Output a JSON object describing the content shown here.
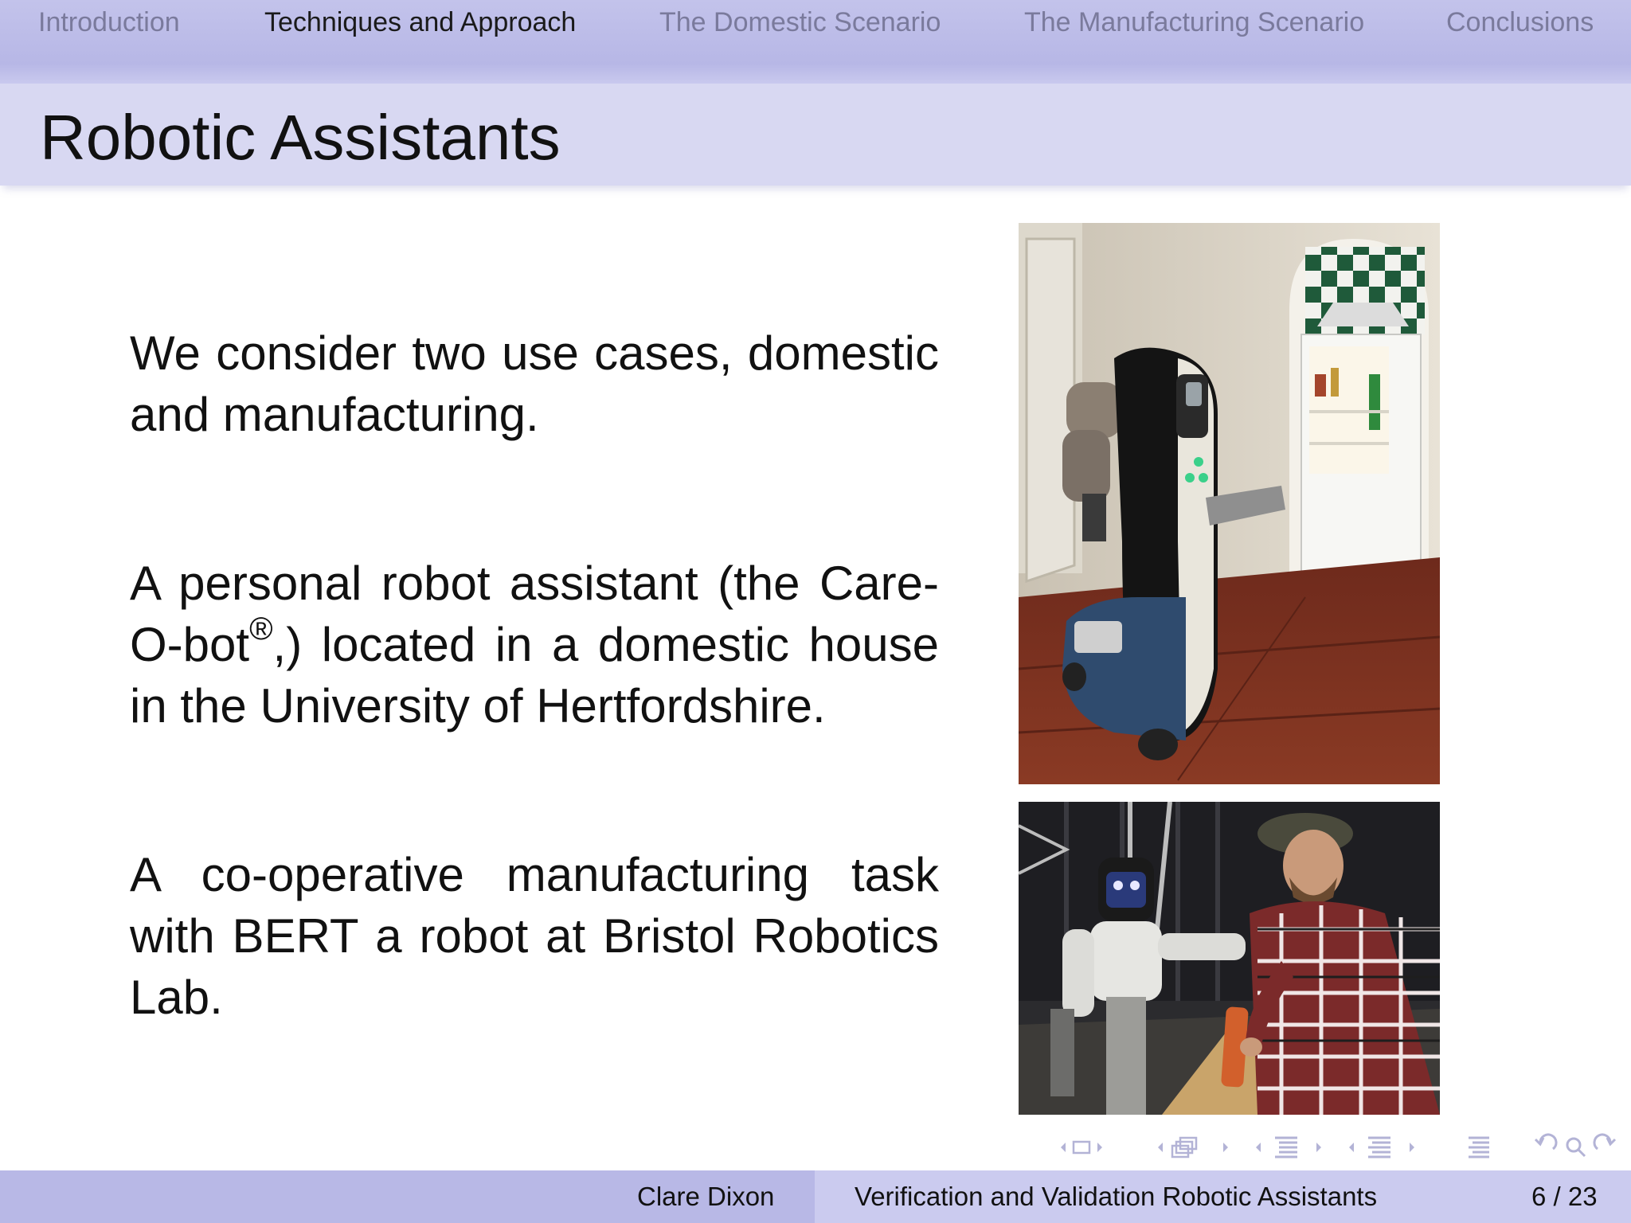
{
  "nav": {
    "sections": [
      {
        "label": "Introduction",
        "active": false
      },
      {
        "label": "Techniques and Approach",
        "active": true
      },
      {
        "label": "The Domestic Scenario",
        "active": false
      },
      {
        "label": "The Manufacturing Scenario",
        "active": false
      },
      {
        "label": "Conclusions",
        "active": false
      }
    ]
  },
  "slide": {
    "title": "Robotic Assistants",
    "paragraphs": {
      "p1": "We consider two use cases, domestic and manufacturing.",
      "p2_before": "A personal robot assistant (the Care-O-bot",
      "p2_mark": "®",
      "p2_after": ",) located in a domestic house in the University of Hertfordshire.",
      "p3": "A co-operative manufacturing task with BERT a robot at Bristol Robotics Lab."
    }
  },
  "images": {
    "carebot": "photo of Care-O-bot robot in a domestic kitchen",
    "bert": "photo of BERT humanoid robot handing an object to a man"
  },
  "footer": {
    "author": "Clare Dixon",
    "title": "Verification and Validation Robotic Assistants",
    "page": "6 / 23"
  },
  "beamer_nav_icons": [
    "frame-prev-icon",
    "frame-icon",
    "frame-next-icon",
    "subsection-prev-icon",
    "subsection-icon",
    "subsection-next-icon",
    "section-prev-icon",
    "section-icon",
    "section-next-icon",
    "doc-prev-icon",
    "doc-icon",
    "doc-next-icon",
    "toc-icon",
    "back-icon",
    "search-icon",
    "forward-icon"
  ],
  "colors": {
    "nav_bg": "#b7b7e6",
    "title_bg": "#d8d8f2",
    "footer_author_bg": "#b8b8e6",
    "footer_title_bg": "#cbcbef",
    "nav_inactive": "#7a7a9c",
    "nav_active": "#1a1a1a"
  }
}
